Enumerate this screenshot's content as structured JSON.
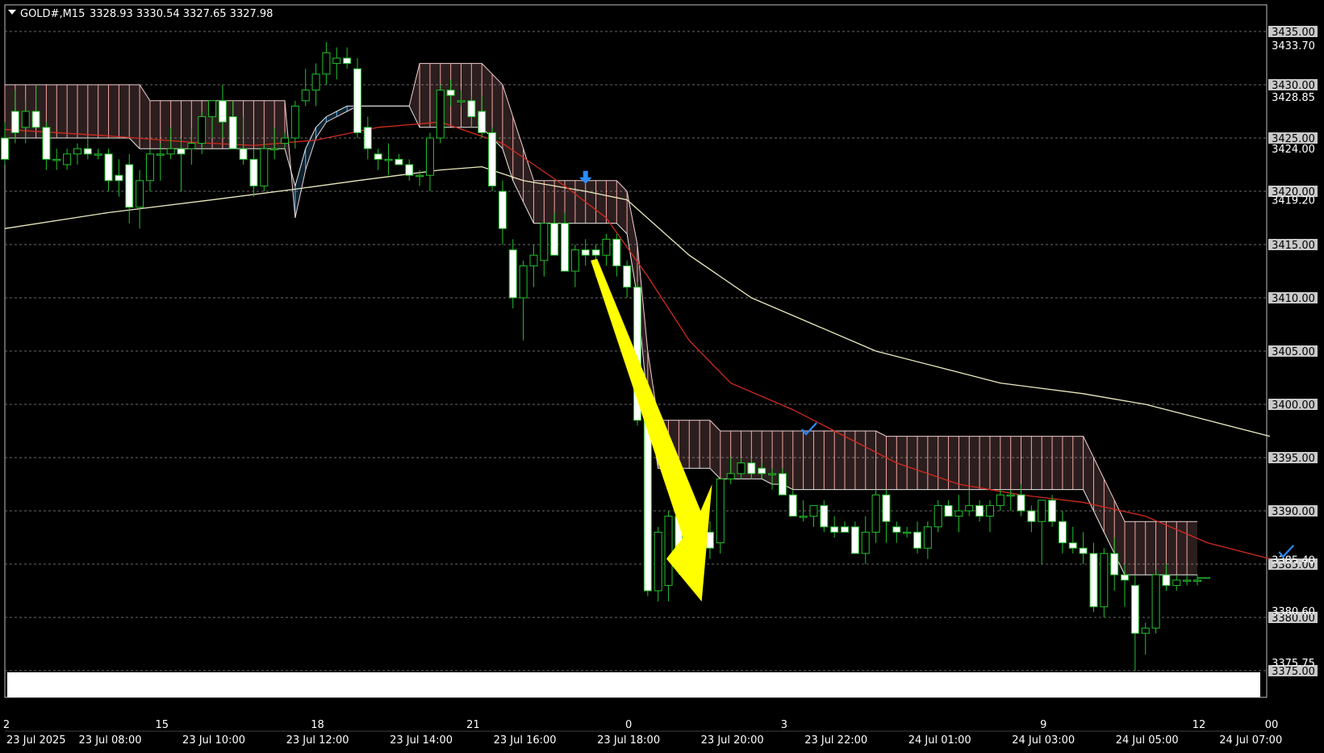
{
  "header": {
    "symbol_label": "GOLD#,M15",
    "ohlc_label": "3328.93 3330.54 3327.65 3327.98"
  },
  "colors": {
    "background": "#000000",
    "frame": "#c0c0c0",
    "grid": "#6a6a6a",
    "bull_body": "#000000",
    "bull_outline": "#22c22a",
    "bear_body": "#ffffff",
    "wick": "#22c22a",
    "cloud_bear": "#f4a4a4",
    "cloud_bull": "#4ab8ff",
    "ma_fast": "#d12a20",
    "ma_slow": "#ecebc0",
    "arrow": "#ffff00",
    "marker": "#2b8cff",
    "price_tag_bg": "#c9c9c9"
  },
  "chart_data": {
    "type": "candlestick",
    "symbol": "GOLD#",
    "timeframe": "M15",
    "ylim": [
      3372.5,
      3437.5
    ],
    "y_ticks": [
      "3435.00",
      "3430.00",
      "3425.00",
      "3420.00",
      "3415.00",
      "3410.00",
      "3405.00",
      "3400.00",
      "3395.00",
      "3390.00",
      "3385.00",
      "3380.00",
      "3375.00"
    ],
    "y_extra_labels": [
      "3433.70",
      "3428.85",
      "3424.00",
      "3419.20",
      "3385.40",
      "3380.60",
      "3375.75"
    ],
    "x_labels": [
      {
        "i": 0,
        "label": "23 Jul 2025"
      },
      {
        "i": 10,
        "label": "23 Jul 08:00"
      },
      {
        "i": 20,
        "label": "23 Jul 10:00"
      },
      {
        "i": 30,
        "label": "23 Jul 12:00"
      },
      {
        "i": 40,
        "label": "23 Jul 14:00"
      },
      {
        "i": 50,
        "label": "23 Jul 16:00"
      },
      {
        "i": 60,
        "label": "23 Jul 18:00"
      },
      {
        "i": 70,
        "label": "23 Jul 20:00"
      },
      {
        "i": 80,
        "label": "23 Jul 22:00"
      },
      {
        "i": 90,
        "label": "24 Jul 01:00"
      },
      {
        "i": 100,
        "label": "24 Jul 03:00"
      },
      {
        "i": 110,
        "label": "24 Jul 05:00"
      },
      {
        "i": 120,
        "label": "24 Jul 07:00"
      }
    ],
    "x_top_labels": [
      {
        "i": 0,
        "label": "2"
      },
      {
        "i": 15,
        "label": "15"
      },
      {
        "i": 30,
        "label": "18"
      },
      {
        "i": 45,
        "label": "21"
      },
      {
        "i": 60,
        "label": "0"
      },
      {
        "i": 75,
        "label": "3"
      },
      {
        "i": 100,
        "label": "9"
      },
      {
        "i": 115,
        "label": "12"
      },
      {
        "i": 122,
        "label": "00"
      }
    ],
    "candles": [
      [
        3425,
        3426.5,
        3422.5,
        3423
      ],
      [
        3427.5,
        3429.5,
        3424.5,
        3425.5
      ],
      [
        3426,
        3428.5,
        3424.5,
        3427.5
      ],
      [
        3427.5,
        3430,
        3426.5,
        3426
      ],
      [
        3426,
        3426.5,
        3422,
        3423
      ],
      [
        3423,
        3424,
        3422,
        3423
      ],
      [
        3422.5,
        3424,
        3422,
        3423.5
      ],
      [
        3423.5,
        3424.5,
        3422.5,
        3424
      ],
      [
        3424,
        3425,
        3423,
        3423.5
      ],
      [
        3423.5,
        3424,
        3423,
        3423.5
      ],
      [
        3423.5,
        3424,
        3420,
        3421
      ],
      [
        3421.5,
        3423,
        3419.5,
        3421
      ],
      [
        3422.5,
        3423.5,
        3417,
        3418.5
      ],
      [
        3418.5,
        3422,
        3416.5,
        3421
      ],
      [
        3421,
        3424,
        3420,
        3423.5
      ],
      [
        3423.5,
        3424.5,
        3421,
        3423.5
      ],
      [
        3423.5,
        3426,
        3423,
        3424
      ],
      [
        3424,
        3425,
        3420,
        3423.5
      ],
      [
        3424,
        3426,
        3422.5,
        3424.5
      ],
      [
        3424.5,
        3427.5,
        3423.5,
        3427
      ],
      [
        3427,
        3428.5,
        3425,
        3428.5
      ],
      [
        3428.5,
        3430,
        3425,
        3426.5
      ],
      [
        3427,
        3428.5,
        3424,
        3424
      ],
      [
        3424,
        3427,
        3422.5,
        3423
      ],
      [
        3423,
        3424,
        3419.5,
        3420.5
      ],
      [
        3420.5,
        3424.5,
        3420,
        3424
      ],
      [
        3424,
        3426,
        3423,
        3424
      ],
      [
        3424.5,
        3425.5,
        3424,
        3425
      ],
      [
        3425,
        3428.5,
        3424,
        3428
      ],
      [
        3428.5,
        3431.5,
        3428,
        3429.5
      ],
      [
        3429.5,
        3432,
        3428,
        3431
      ],
      [
        3431,
        3434,
        3430,
        3433
      ],
      [
        3432,
        3433.5,
        3430.5,
        3432.5
      ],
      [
        3432.5,
        3433.5,
        3431.5,
        3432
      ],
      [
        3431.5,
        3432.5,
        3425,
        3425.5
      ],
      [
        3426,
        3427,
        3423,
        3424
      ],
      [
        3423.5,
        3424,
        3422,
        3423
      ],
      [
        3423,
        3424.5,
        3421.5,
        3423
      ],
      [
        3423,
        3423.5,
        3422.5,
        3422.5
      ],
      [
        3422.5,
        3423,
        3421,
        3421.5
      ],
      [
        3421.5,
        3422,
        3420.5,
        3421.5
      ],
      [
        3421.5,
        3425.5,
        3420,
        3425
      ],
      [
        3425,
        3430,
        3424.5,
        3429.5
      ],
      [
        3429.5,
        3430.5,
        3428,
        3429
      ],
      [
        3428.5,
        3429.5,
        3428,
        3428.5
      ],
      [
        3428.5,
        3429,
        3426,
        3427
      ],
      [
        3427.5,
        3429,
        3425,
        3425.5
      ],
      [
        3425.5,
        3426,
        3420,
        3420.5
      ],
      [
        3420,
        3421,
        3415,
        3416.5
      ],
      [
        3414.5,
        3415.5,
        3409,
        3410
      ],
      [
        3410,
        3413.5,
        3406,
        3413
      ],
      [
        3413,
        3415,
        3411,
        3414
      ],
      [
        3413.5,
        3417,
        3412,
        3417
      ],
      [
        3417,
        3418,
        3415,
        3414
      ],
      [
        3417,
        3418,
        3413,
        3412.5
      ],
      [
        3412.5,
        3415,
        3411,
        3414.5
      ],
      [
        3414.5,
        3415.5,
        3413,
        3414
      ],
      [
        3414.5,
        3415,
        3412,
        3414
      ],
      [
        3414,
        3416,
        3413,
        3415.5
      ],
      [
        3415.5,
        3416,
        3412,
        3413
      ],
      [
        3413,
        3413.5,
        3410,
        3411
      ],
      [
        3411,
        3411.5,
        3398,
        3398.5
      ],
      [
        3398.5,
        3399,
        3382,
        3382.5
      ],
      [
        3382.5,
        3388.5,
        3381.5,
        3388
      ],
      [
        3383,
        3390,
        3381.5,
        3389.5
      ],
      [
        3389.5,
        3390,
        3384,
        3386.5
      ],
      [
        3386.5,
        3390,
        3384.5,
        3389.5
      ],
      [
        3389.5,
        3390,
        3386.5,
        3388
      ],
      [
        3388,
        3389,
        3385.5,
        3386.5
      ],
      [
        3387,
        3393,
        3386,
        3393
      ],
      [
        3393,
        3395,
        3392.5,
        3393.5
      ],
      [
        3393.5,
        3395,
        3393,
        3394.5
      ],
      [
        3394.5,
        3395,
        3393,
        3393.5
      ],
      [
        3394,
        3394.5,
        3393,
        3393.5
      ],
      [
        3393.5,
        3394,
        3392,
        3393.5
      ],
      [
        3393.5,
        3394,
        3391.5,
        3391.5
      ],
      [
        3391.5,
        3392,
        3389.5,
        3389.5
      ],
      [
        3389.5,
        3391,
        3389,
        3389.5
      ],
      [
        3389.5,
        3390.5,
        3388.5,
        3390.5
      ],
      [
        3390.5,
        3391,
        3388,
        3388.5
      ],
      [
        3388.5,
        3389.5,
        3387.5,
        3388
      ],
      [
        3388.5,
        3389,
        3388,
        3388
      ],
      [
        3388.5,
        3389,
        3386,
        3386
      ],
      [
        3386,
        3389.5,
        3385,
        3388
      ],
      [
        3388,
        3392,
        3387,
        3391.5
      ],
      [
        3391.5,
        3392,
        3387,
        3389
      ],
      [
        3388.5,
        3389,
        3387,
        3388
      ],
      [
        3388,
        3388.5,
        3387.5,
        3388
      ],
      [
        3388,
        3389,
        3386,
        3386.5
      ],
      [
        3386.5,
        3389,
        3385.5,
        3388.5
      ],
      [
        3388.5,
        3391,
        3388,
        3390.5
      ],
      [
        3390.5,
        3391,
        3389.5,
        3389.5
      ],
      [
        3389.5,
        3391.5,
        3388,
        3390
      ],
      [
        3390,
        3392,
        3389.5,
        3390.5
      ],
      [
        3390.5,
        3391,
        3389,
        3389.5
      ],
      [
        3389.5,
        3391,
        3388,
        3390.5
      ],
      [
        3390.5,
        3392,
        3390,
        3391.5
      ],
      [
        3391.5,
        3392,
        3390,
        3391.5
      ],
      [
        3391.5,
        3392.5,
        3389.5,
        3390
      ],
      [
        3390,
        3390.5,
        3388,
        3389
      ],
      [
        3389,
        3391,
        3385,
        3391
      ],
      [
        3391,
        3391.5,
        3388.5,
        3389
      ],
      [
        3389,
        3390,
        3386,
        3387
      ],
      [
        3387,
        3388.5,
        3386,
        3386.5
      ],
      [
        3386.5,
        3388,
        3385,
        3386
      ],
      [
        3386,
        3387,
        3380.5,
        3381
      ],
      [
        3381,
        3386.5,
        3380,
        3386
      ],
      [
        3386,
        3387.5,
        3382.5,
        3384
      ],
      [
        3384,
        3385,
        3381,
        3383.5
      ],
      [
        3383,
        3384,
        3375,
        3378.5
      ],
      [
        3378.5,
        3379.5,
        3376.5,
        3379
      ],
      [
        3379,
        3384.5,
        3378.5,
        3384
      ],
      [
        3384,
        3385,
        3382.5,
        3383
      ],
      [
        3383,
        3384,
        3382.5,
        3383.5
      ],
      [
        3383.5,
        3384,
        3383,
        3383.5
      ],
      [
        3383.5,
        3384,
        3383,
        3383.5
      ]
    ],
    "cloud": [
      [
        3430,
        3425
      ],
      [
        3430,
        3425
      ],
      [
        3430,
        3425
      ],
      [
        3430,
        3425
      ],
      [
        3430,
        3425
      ],
      [
        3430,
        3425
      ],
      [
        3430,
        3425
      ],
      [
        3430,
        3425
      ],
      [
        3430,
        3425
      ],
      [
        3430,
        3425
      ],
      [
        3430,
        3425
      ],
      [
        3430,
        3425
      ],
      [
        3430,
        3425
      ],
      [
        3430,
        3424
      ],
      [
        3428.5,
        3424
      ],
      [
        3428.5,
        3424
      ],
      [
        3428.5,
        3424
      ],
      [
        3428.5,
        3424
      ],
      [
        3428.5,
        3424
      ],
      [
        3428.5,
        3424
      ],
      [
        3428.5,
        3424
      ],
      [
        3428.5,
        3424
      ],
      [
        3428.5,
        3424
      ],
      [
        3428.5,
        3424
      ],
      [
        3428.5,
        3424
      ],
      [
        3428.5,
        3424
      ],
      [
        3428.5,
        3424
      ],
      [
        3428.5,
        3424
      ],
      [
        3417.5,
        3420.5
      ],
      [
        3422,
        3424
      ],
      [
        3425,
        3426
      ],
      [
        3426.5,
        3427
      ],
      [
        3427,
        3427.5
      ],
      [
        3427.5,
        3428
      ],
      [
        3428,
        3428
      ],
      [
        3428,
        3428
      ],
      [
        3428,
        3428
      ],
      [
        3428,
        3428
      ],
      [
        3428,
        3428
      ],
      [
        3428,
        3428
      ],
      [
        3432,
        3426
      ],
      [
        3432,
        3426
      ],
      [
        3432,
        3426
      ],
      [
        3432,
        3426
      ],
      [
        3432,
        3426
      ],
      [
        3432,
        3426
      ],
      [
        3432,
        3426
      ],
      [
        3431,
        3425
      ],
      [
        3430,
        3424
      ],
      [
        3427,
        3421
      ],
      [
        3424,
        3419
      ],
      [
        3421,
        3417
      ],
      [
        3421,
        3417
      ],
      [
        3421,
        3417
      ],
      [
        3421,
        3417
      ],
      [
        3421,
        3417
      ],
      [
        3421,
        3417
      ],
      [
        3421,
        3417
      ],
      [
        3421,
        3417
      ],
      [
        3421,
        3417
      ],
      [
        3420,
        3416
      ],
      [
        3415,
        3410
      ],
      [
        3405,
        3400
      ],
      [
        3398.5,
        3394
      ],
      [
        3398.5,
        3394
      ],
      [
        3398.5,
        3394
      ],
      [
        3398.5,
        3394
      ],
      [
        3398.5,
        3394
      ],
      [
        3398.5,
        3394
      ],
      [
        3397.5,
        3393
      ],
      [
        3397.5,
        3393
      ],
      [
        3397.5,
        3393
      ],
      [
        3397.5,
        3393
      ],
      [
        3397.5,
        3393
      ],
      [
        3397.5,
        3392.5
      ],
      [
        3397.5,
        3392.5
      ],
      [
        3397.5,
        3392
      ],
      [
        3397.5,
        3392
      ],
      [
        3397.5,
        3392
      ],
      [
        3397.5,
        3392
      ],
      [
        3397.5,
        3392
      ],
      [
        3397.5,
        3392
      ],
      [
        3397.5,
        3392
      ],
      [
        3397.5,
        3392
      ],
      [
        3397.5,
        3392
      ],
      [
        3397,
        3392
      ],
      [
        3397,
        3392
      ],
      [
        3397,
        3392
      ],
      [
        3397,
        3392
      ],
      [
        3397,
        3392
      ],
      [
        3397,
        3392
      ],
      [
        3397,
        3392
      ],
      [
        3397,
        3392
      ],
      [
        3397,
        3392
      ],
      [
        3397,
        3392
      ],
      [
        3397,
        3392
      ],
      [
        3397,
        3392
      ],
      [
        3397,
        3392
      ],
      [
        3397,
        3392
      ],
      [
        3397,
        3392
      ],
      [
        3397,
        3392
      ],
      [
        3397,
        3392
      ],
      [
        3397,
        3392
      ],
      [
        3397,
        3392
      ],
      [
        3397,
        3392
      ],
      [
        3395,
        3390
      ],
      [
        3393,
        3388
      ],
      [
        3391,
        3386
      ],
      [
        3389,
        3384
      ],
      [
        3389,
        3384
      ],
      [
        3389,
        3384
      ],
      [
        3389,
        3384
      ],
      [
        3389,
        3384
      ],
      [
        3389,
        3384
      ],
      [
        3389,
        3384
      ],
      [
        3389,
        3384
      ]
    ],
    "ma_fast": [
      [
        0,
        3425.8
      ],
      [
        10,
        3425.2
      ],
      [
        18,
        3424.6
      ],
      [
        24,
        3424.3
      ],
      [
        30,
        3424.8
      ],
      [
        36,
        3426
      ],
      [
        42,
        3426.5
      ],
      [
        48,
        3424.5
      ],
      [
        54,
        3420.5
      ],
      [
        58,
        3417.5
      ],
      [
        62,
        3412
      ],
      [
        66,
        3406
      ],
      [
        70,
        3402
      ],
      [
        76,
        3399.5
      ],
      [
        80,
        3397.5
      ],
      [
        86,
        3394.5
      ],
      [
        92,
        3392.5
      ],
      [
        98,
        3391.5
      ],
      [
        104,
        3390.8
      ],
      [
        110,
        3389.5
      ],
      [
        116,
        3387
      ],
      [
        122,
        3385.5
      ]
    ],
    "ma_slow": [
      [
        0,
        3416.5
      ],
      [
        10,
        3418
      ],
      [
        20,
        3419.2
      ],
      [
        28,
        3420.2
      ],
      [
        34,
        3421
      ],
      [
        42,
        3422
      ],
      [
        46,
        3422.3
      ],
      [
        50,
        3421
      ],
      [
        56,
        3420
      ],
      [
        60,
        3419.2
      ],
      [
        66,
        3414
      ],
      [
        72,
        3410
      ],
      [
        78,
        3407.5
      ],
      [
        84,
        3405
      ],
      [
        90,
        3403.5
      ],
      [
        96,
        3402
      ],
      [
        104,
        3401
      ],
      [
        110,
        3400
      ],
      [
        116,
        3398.5
      ],
      [
        122,
        3397
      ]
    ],
    "current_price": 3383.7
  }
}
